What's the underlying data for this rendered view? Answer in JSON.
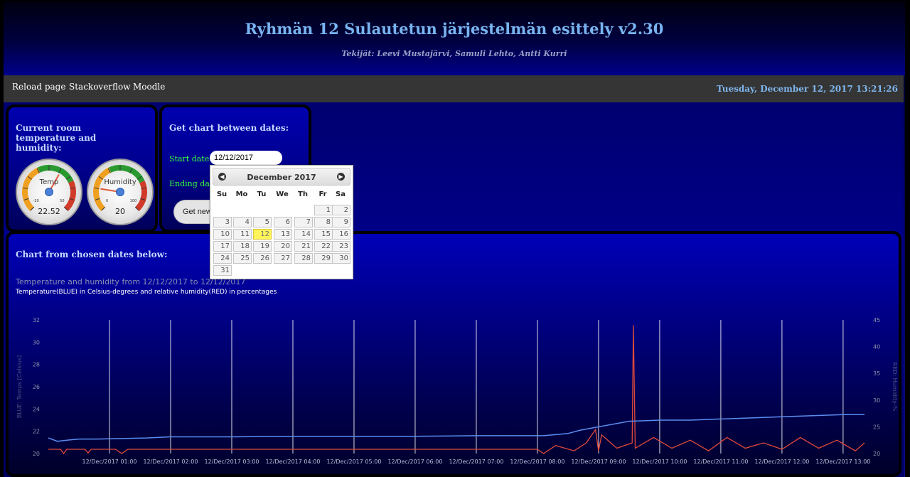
{
  "header": {
    "title": "Ryhmän 12 Sulautetun järjestelmän esittely v2.30",
    "authors": "Tekijät: Leevi Mustajärvi, Samuli Lehto, Antti Kurri"
  },
  "navbar": {
    "links": [
      "Reload page",
      "Stackoverflow",
      "Moodle"
    ],
    "datetime": "Tuesday, December 12, 2017 13:21:26"
  },
  "current_panel": {
    "title": "Current room temperature and humidity:",
    "gauges": [
      {
        "label": "Temp",
        "value": "22.52",
        "min": "-20",
        "max": "50",
        "fraction": 0.61
      },
      {
        "label": "Humidity",
        "value": "20",
        "min": "0",
        "max": "100",
        "fraction": 0.2
      }
    ]
  },
  "date_panel": {
    "title": "Get chart between dates:",
    "start_label": "Start date:",
    "start_value": "12/12/2017",
    "end_label": "Ending date:",
    "button_label": "Get new"
  },
  "datepicker": {
    "month_title": "December 2017",
    "prev_label": "◀",
    "next_label": "▶",
    "weekdays": [
      "Su",
      "Mo",
      "Tu",
      "We",
      "Th",
      "Fr",
      "Sa"
    ],
    "first_weekday_index": 5,
    "days_in_month": 31,
    "selected_day": 12
  },
  "chart_panel": {
    "heading": "Chart from chosen dates below:",
    "title": "Temperature and humidity from 12/12/2017 to 12/12/2017",
    "subtitle": "Temperature(BLUE) in Celsius-degrees and relative humidity(RED) in percentages"
  },
  "chart_data": {
    "type": "line",
    "title": "Temperature and humidity from 12/12/2017 to 12/12/2017",
    "y_left_label": "BLUE: Temps [Celsius]",
    "y_right_label": "RED: Humidity-%",
    "y_left_ticks": [
      "20",
      "22",
      "24",
      "26",
      "28",
      "30",
      "32"
    ],
    "y_right_ticks": [
      "20",
      "25",
      "30",
      "35",
      "40",
      "45"
    ],
    "ylim_left": [
      20,
      32
    ],
    "ylim_right": [
      20,
      45
    ],
    "x_ticks": [
      "12/Dec/2017 01:00",
      "12/Dec/2017 02:00",
      "12/Dec/2017 03:00",
      "12/Dec/2017 04:00",
      "12/Dec/2017 05:00",
      "12/Dec/2017 06:00",
      "12/Dec/2017 07:00",
      "12/Dec/2017 08:00",
      "12/Dec/2017 09:00",
      "12/Dec/2017 10:00",
      "12/Dec/2017 11:00",
      "12/Dec/2017 12:00",
      "12/Dec/2017 13:00"
    ],
    "x_range_hours": [
      0.0,
      13.35
    ],
    "series": [
      {
        "name": "Temperature",
        "color": "#5b8df0",
        "x": [
          0.0,
          0.15,
          0.3,
          0.5,
          0.8,
          1.2,
          1.6,
          2.0,
          3.0,
          4.0,
          5.0,
          6.0,
          7.0,
          8.0,
          8.1,
          8.3,
          8.5,
          8.7,
          8.9,
          9.1,
          9.3,
          9.5,
          10.0,
          10.5,
          11.0,
          11.5,
          12.0,
          12.5,
          13.0,
          13.35
        ],
        "values": [
          21.4,
          21.1,
          21.2,
          21.3,
          21.3,
          21.35,
          21.4,
          21.5,
          21.5,
          21.55,
          21.55,
          21.55,
          21.6,
          21.6,
          21.6,
          21.7,
          21.8,
          22.1,
          22.3,
          22.5,
          22.7,
          22.9,
          23.0,
          23.0,
          23.1,
          23.2,
          23.3,
          23.4,
          23.5,
          23.5
        ]
      },
      {
        "name": "Humidity",
        "color": "#e04a3a",
        "x": [
          0.0,
          0.2,
          0.25,
          0.3,
          0.6,
          0.65,
          0.7,
          1.1,
          1.2,
          1.3,
          2.0,
          4.0,
          6.0,
          8.0,
          8.1,
          8.3,
          8.6,
          8.8,
          8.95,
          9.0,
          9.05,
          9.3,
          9.55,
          9.57,
          9.6,
          9.9,
          10.2,
          10.5,
          10.8,
          11.1,
          11.4,
          11.7,
          12.0,
          12.3,
          12.6,
          12.9,
          13.2,
          13.35
        ],
        "values": [
          20.8,
          20.8,
          20.0,
          20.8,
          20.8,
          20.1,
          20.8,
          20.8,
          20.0,
          20.8,
          20.8,
          20.8,
          20.8,
          20.8,
          20.0,
          21.5,
          20.5,
          22.0,
          24.5,
          20.5,
          23.5,
          21.0,
          22.0,
          44.0,
          21.0,
          23.0,
          21.0,
          22.5,
          20.5,
          23.0,
          21.0,
          22.0,
          20.8,
          23.0,
          21.0,
          22.5,
          20.5,
          22.0
        ]
      }
    ]
  }
}
